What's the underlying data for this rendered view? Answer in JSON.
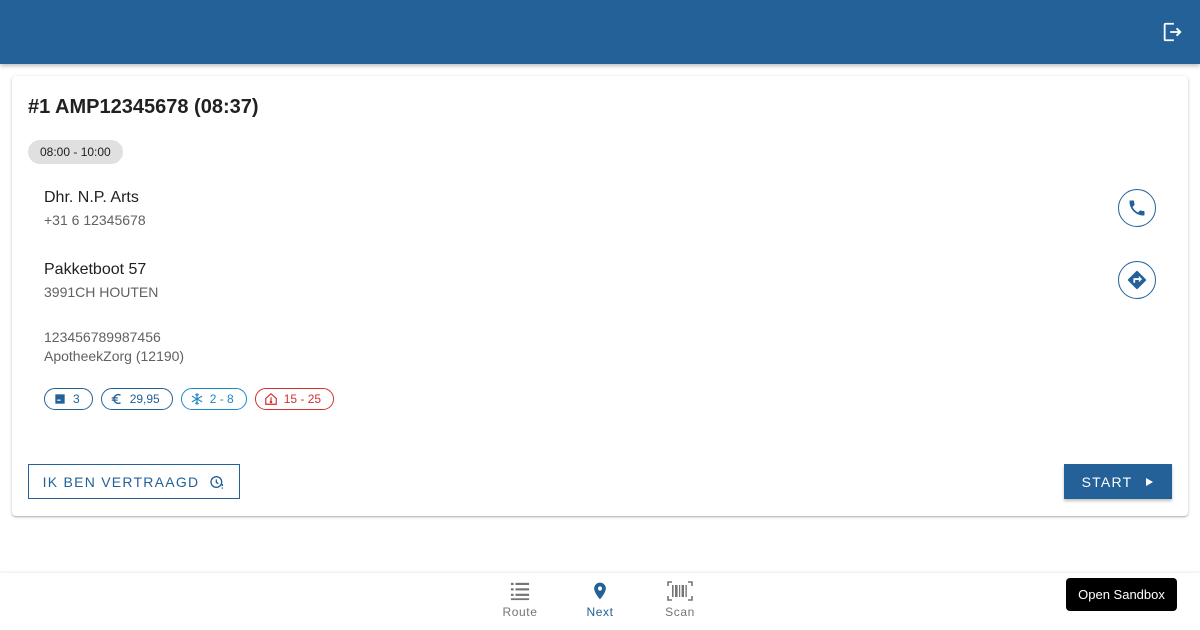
{
  "header": {
    "logout_icon": "logout-icon"
  },
  "stop": {
    "title": "#1 AMP12345678 (08:37)",
    "time_window": "08:00 - 10:00",
    "contact": {
      "name": "Dhr. N.P. Arts",
      "phone": "+31 6 12345678",
      "action_icon": "phone-icon"
    },
    "address": {
      "street": "Pakketboot 57",
      "city": "3991CH HOUTEN",
      "action_icon": "directions-icon"
    },
    "shipment": {
      "tracking": "123456789987456",
      "sender": "ApotheekZorg (12190)"
    },
    "chips": [
      {
        "icon": "package-icon",
        "label": "3",
        "color": "#236198"
      },
      {
        "icon": "euro-icon",
        "label": "29,95",
        "color": "#236198"
      },
      {
        "icon": "snowflake-icon",
        "label": "2 - 8",
        "color": "#1e88c8"
      },
      {
        "icon": "thermometer-icon",
        "label": "15 - 25",
        "color": "#d32f2f"
      }
    ],
    "delay_button": {
      "label": "IK BEN VERTRAAGD",
      "icon": "clock-alert-icon"
    },
    "start_button": {
      "label": "START",
      "icon": "play-arrow-icon"
    }
  },
  "bottom_nav": [
    {
      "label": "Route",
      "icon": "list-icon",
      "active": false
    },
    {
      "label": "Next",
      "icon": "location-pin-icon",
      "active": true
    },
    {
      "label": "Scan",
      "icon": "barcode-icon",
      "active": false
    }
  ],
  "sandbox_button": {
    "label": "Open Sandbox"
  },
  "colors": {
    "primary": "#236198",
    "inactive": "#757575",
    "cold": "#1e88c8",
    "warm": "#d32f2f"
  }
}
